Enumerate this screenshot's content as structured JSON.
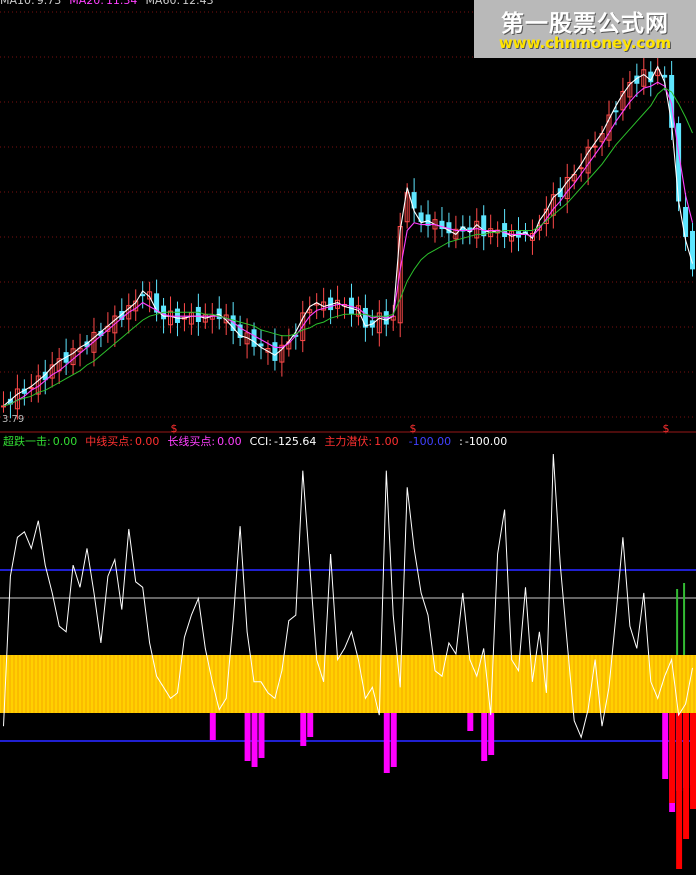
{
  "colors": {
    "background": "#000000",
    "grid": "#7a1010",
    "candle_up": "#ff4a4a",
    "candle_down": "#5ee6ff",
    "ma_short": "#ffffff",
    "ma_mid": "#ff40ff",
    "ma_long": "#2cc02c",
    "cci": "#ffffff",
    "band": "#2020d0",
    "midline": "#cccccc",
    "yellow_block": "#ffd000",
    "magenta_bars": "#ff00ff",
    "red_bars": "#ff0000",
    "green_bars": "#33bb33"
  },
  "price_panel": {
    "legend": [
      {
        "label": "MA10:",
        "value": "9.73",
        "color": "#cccccc"
      },
      {
        "label": "MA20:",
        "value": "11.34",
        "color": "#ff40ff"
      },
      {
        "label": "MA60:",
        "value": "12.43",
        "color": "#cccccc"
      }
    ],
    "low_label": "3.79"
  },
  "indicator_panel": {
    "legend": [
      {
        "label": "超跌一击:",
        "value": "0.00",
        "color": "#33dd33"
      },
      {
        "label": "中线买点:",
        "value": "0.00",
        "color": "#ff3030"
      },
      {
        "label": "长线买点:",
        "value": "0.00",
        "color": "#ff40ff"
      },
      {
        "label": "CCI:",
        "value": "-125.64",
        "color": "#ffffff"
      },
      {
        "label": "主力潜伏:",
        "value": "1.00",
        "color": "#ff3030"
      },
      {
        "label": "",
        "value": "-100.00",
        "color": "#4040ff"
      },
      {
        "label": ":",
        "value": "-100.00",
        "color": "#ffffff"
      }
    ],
    "dollar_marker": "$"
  },
  "watermark": {
    "title": "第一股票公式网",
    "url": "www.chnmoney.com"
  },
  "chart_data": [
    {
      "type": "line",
      "panel": "price",
      "x_count": 100,
      "ylim": [
        3.79,
        22
      ],
      "series": [
        {
          "name": "MA10",
          "values": [
            4.0,
            4.3,
            4.6,
            4.8,
            5.0,
            5.3,
            5.6,
            6.0,
            6.3,
            6.5,
            6.7,
            7.0,
            7.2,
            7.5,
            7.8,
            8.1,
            8.4,
            8.7,
            9.0,
            9.3,
            9.9,
            9.6,
            8.9,
            8.6,
            8.6,
            8.5,
            8.5,
            8.6,
            8.6,
            8.5,
            8.6,
            8.7,
            8.4,
            8.0,
            7.6,
            7.5,
            7.3,
            7.0,
            6.8,
            6.6,
            6.9,
            7.3,
            7.8,
            8.5,
            9.1,
            9.3,
            9.1,
            9.2,
            9.3,
            9.1,
            9.0,
            8.9,
            8.1,
            8.2,
            8.5,
            8.4,
            8.6,
            13.0,
            15.2,
            14.0,
            13.4,
            13.5,
            13.3,
            13.2,
            13.0,
            12.8,
            13.2,
            12.9,
            13.3,
            13.0,
            12.9,
            13.0,
            12.9,
            12.7,
            12.8,
            12.9,
            12.6,
            13.5,
            14.0,
            14.7,
            15.0,
            15.5,
            15.9,
            16.4,
            17.0,
            17.5,
            18.0,
            18.7,
            19.4,
            20.0,
            20.5,
            20.8,
            21.0,
            20.7,
            21.4,
            20.6,
            18.5,
            14.5,
            12.5,
            11.3
          ]
        },
        {
          "name": "MA20",
          "values": [
            4.0,
            4.1,
            4.3,
            4.5,
            4.8,
            5.0,
            5.3,
            5.6,
            5.8,
            6.1,
            6.4,
            6.7,
            7.0,
            7.3,
            7.6,
            7.9,
            8.2,
            8.5,
            8.8,
            9.0,
            9.3,
            9.1,
            8.9,
            8.7,
            8.6,
            8.6,
            8.6,
            8.6,
            8.6,
            8.6,
            8.6,
            8.6,
            8.5,
            8.3,
            8.0,
            7.8,
            7.6,
            7.4,
            7.2,
            7.0,
            7.0,
            7.2,
            7.6,
            8.1,
            8.6,
            8.9,
            9.0,
            9.1,
            9.2,
            9.2,
            9.1,
            9.0,
            8.7,
            8.5,
            8.6,
            8.5,
            8.6,
            11.0,
            13.0,
            13.4,
            13.3,
            13.3,
            13.3,
            13.2,
            13.1,
            13.0,
            13.0,
            13.0,
            13.1,
            13.0,
            13.0,
            13.0,
            12.9,
            12.8,
            12.8,
            12.8,
            12.7,
            13.1,
            13.6,
            14.1,
            14.5,
            15.0,
            15.4,
            15.9,
            16.4,
            16.9,
            17.4,
            18.0,
            18.6,
            19.1,
            19.6,
            20.0,
            20.3,
            20.4,
            20.6,
            20.4,
            19.5,
            17.0,
            14.8,
            13.4
          ]
        },
        {
          "name": "MA60",
          "values": [
            4.0,
            4.1,
            4.3,
            4.4,
            4.5,
            4.7,
            4.8,
            5.0,
            5.2,
            5.4,
            5.6,
            5.8,
            6.1,
            6.3,
            6.6,
            6.9,
            7.2,
            7.5,
            7.8,
            8.1,
            8.4,
            8.6,
            8.7,
            8.8,
            8.8,
            8.8,
            8.8,
            8.8,
            8.8,
            8.7,
            8.7,
            8.6,
            8.5,
            8.4,
            8.3,
            8.2,
            8.1,
            7.9,
            7.8,
            7.7,
            7.6,
            7.6,
            7.7,
            7.9,
            8.0,
            8.2,
            8.3,
            8.5,
            8.6,
            8.7,
            8.7,
            8.7,
            8.7,
            8.6,
            8.6,
            8.6,
            8.7,
            9.5,
            10.4,
            11.0,
            11.5,
            11.8,
            12.0,
            12.2,
            12.4,
            12.5,
            12.6,
            12.7,
            12.8,
            12.8,
            12.9,
            12.9,
            13.0,
            13.0,
            13.0,
            13.0,
            13.0,
            13.2,
            13.5,
            13.8,
            14.1,
            14.4,
            14.8,
            15.2,
            15.6,
            16.0,
            16.4,
            16.9,
            17.4,
            17.8,
            18.2,
            18.6,
            19.0,
            19.4,
            20.0,
            20.3,
            20.1,
            19.5,
            18.8,
            18.0
          ]
        }
      ]
    },
    {
      "type": "line",
      "panel": "indicator",
      "x_count": 100,
      "ylim": [
        -500,
        300
      ],
      "levels": [
        100,
        0,
        -100,
        -200
      ],
      "series": [
        {
          "name": "CCI",
          "values": [
            -230,
            40,
            110,
            120,
            90,
            140,
            60,
            10,
            -50,
            -60,
            60,
            20,
            90,
            10,
            -80,
            40,
            70,
            -20,
            125,
            30,
            20,
            -80,
            -140,
            -160,
            -180,
            -170,
            -70,
            -30,
            0,
            -90,
            -150,
            -200,
            -180,
            -40,
            130,
            -60,
            -150,
            -150,
            -170,
            -180,
            -130,
            -40,
            -30,
            230,
            60,
            -110,
            -150,
            80,
            -110,
            -90,
            -60,
            -110,
            -180,
            -160,
            -210,
            230,
            -30,
            -160,
            200,
            90,
            10,
            -30,
            -130,
            -140,
            -80,
            -100,
            10,
            -110,
            -140,
            -90,
            -210,
            80,
            160,
            -110,
            -130,
            20,
            -150,
            -60,
            -170,
            260,
            60,
            -80,
            -220,
            -250,
            -200,
            -110,
            -230,
            -160,
            -30,
            110,
            -50,
            -90,
            10,
            -150,
            -180,
            -140,
            -110,
            -210,
            -190,
            -125
          ]
        },
        {
          "name": "magenta",
          "values": [
            0,
            0,
            0,
            0,
            0,
            0,
            0,
            0,
            0,
            0,
            0,
            0,
            0,
            0,
            0,
            0,
            0,
            0,
            0,
            0,
            0,
            0,
            0,
            0,
            0,
            0,
            0,
            0,
            0,
            0,
            -90,
            0,
            0,
            0,
            0,
            -160,
            -180,
            -150,
            0,
            0,
            0,
            0,
            0,
            -110,
            -80,
            0,
            0,
            0,
            0,
            0,
            0,
            0,
            0,
            0,
            0,
            -200,
            -180,
            0,
            0,
            0,
            0,
            0,
            0,
            0,
            0,
            0,
            0,
            -60,
            0,
            -160,
            -140,
            0,
            0,
            0,
            0,
            0,
            0,
            0,
            0,
            0,
            0,
            0,
            0,
            0,
            0,
            0,
            0,
            0,
            0,
            0,
            0,
            0,
            0,
            0,
            0,
            -220,
            -330,
            -260,
            -250,
            -240
          ]
        },
        {
          "name": "red",
          "values": [
            0,
            0,
            0,
            0,
            0,
            0,
            0,
            0,
            0,
            0,
            0,
            0,
            0,
            0,
            0,
            0,
            0,
            0,
            0,
            0,
            0,
            0,
            0,
            0,
            0,
            0,
            0,
            0,
            0,
            0,
            0,
            0,
            0,
            0,
            0,
            0,
            0,
            0,
            0,
            0,
            0,
            0,
            0,
            0,
            0,
            0,
            0,
            0,
            0,
            0,
            0,
            0,
            0,
            0,
            0,
            0,
            0,
            0,
            0,
            0,
            0,
            0,
            0,
            0,
            0,
            0,
            0,
            0,
            0,
            0,
            0,
            0,
            0,
            0,
            0,
            0,
            0,
            0,
            0,
            0,
            0,
            0,
            0,
            0,
            0,
            0,
            0,
            0,
            0,
            0,
            0,
            0,
            0,
            0,
            0,
            0,
            -300,
            -520,
            -420,
            -320
          ]
        },
        {
          "name": "green",
          "values": [
            0,
            0,
            0,
            0,
            0,
            0,
            0,
            0,
            0,
            0,
            0,
            0,
            0,
            0,
            0,
            0,
            0,
            0,
            0,
            0,
            0,
            0,
            0,
            0,
            0,
            0,
            0,
            0,
            0,
            0,
            0,
            0,
            0,
            0,
            0,
            0,
            0,
            0,
            0,
            0,
            0,
            0,
            0,
            0,
            0,
            0,
            0,
            0,
            0,
            0,
            0,
            0,
            0,
            0,
            0,
            0,
            0,
            0,
            0,
            0,
            0,
            0,
            0,
            0,
            0,
            0,
            0,
            0,
            0,
            0,
            0,
            0,
            0,
            0,
            0,
            0,
            0,
            0,
            0,
            0,
            0,
            0,
            0,
            0,
            0,
            0,
            0,
            0,
            0,
            0,
            0,
            0,
            0,
            0,
            0,
            0,
            0,
            220,
            240,
            0
          ]
        }
      ]
    }
  ]
}
